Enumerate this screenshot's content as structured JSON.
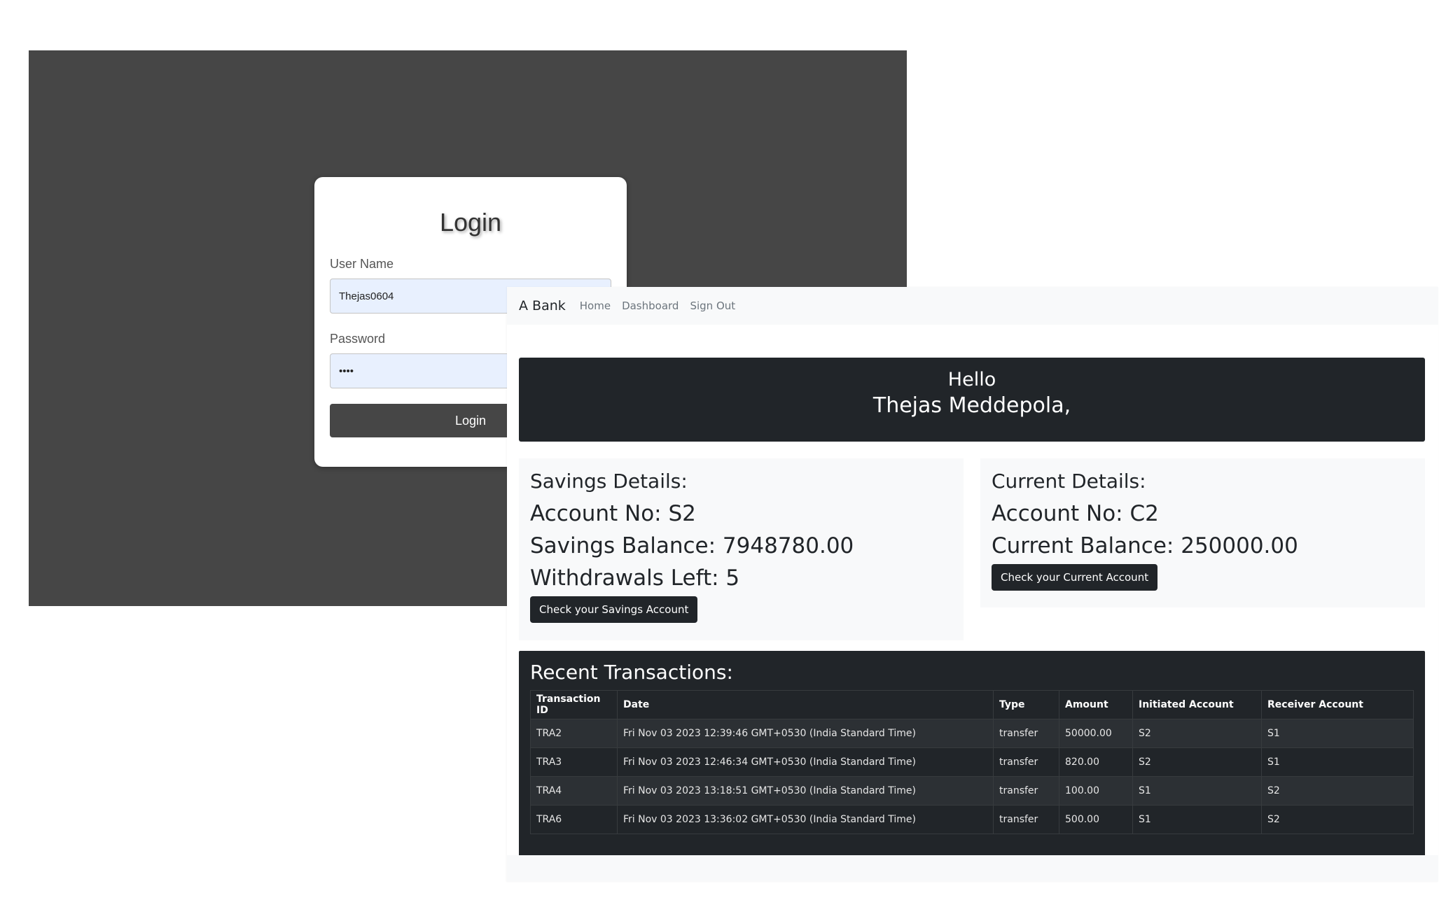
{
  "login": {
    "title": "Login",
    "username_label": "User Name",
    "username_value": "Thejas0604",
    "password_label": "Password",
    "password_value": "••••",
    "button_label": "Login"
  },
  "bank": {
    "navbar": {
      "brand": "A Bank",
      "links": [
        "Home",
        "Dashboard",
        "Sign Out"
      ]
    },
    "greeting": {
      "line1": "Hello",
      "line2": "Thejas Meddepola,"
    },
    "savings": {
      "heading": "Savings Details:",
      "account_no": "Account No: S2",
      "balance": "Savings Balance: 7948780.00",
      "withdrawals": "Withdrawals Left: 5",
      "button": "Check your Savings Account"
    },
    "current": {
      "heading": "Current Details:",
      "account_no": "Account No: C2",
      "balance": "Current Balance: 250000.00",
      "button": "Check your Current Account"
    },
    "transactions": {
      "heading": "Recent Transactions:",
      "columns": [
        "Transaction ID",
        "Date",
        "Type",
        "Amount",
        "Initiated Account",
        "Receiver Account"
      ],
      "rows": [
        [
          "TRA2",
          "Fri Nov 03 2023 12:39:46 GMT+0530 (India Standard Time)",
          "transfer",
          "50000.00",
          "S2",
          "S1"
        ],
        [
          "TRA3",
          "Fri Nov 03 2023 12:46:34 GMT+0530 (India Standard Time)",
          "transfer",
          "820.00",
          "S2",
          "S1"
        ],
        [
          "TRA4",
          "Fri Nov 03 2023 13:18:51 GMT+0530 (India Standard Time)",
          "transfer",
          "100.00",
          "S1",
          "S2"
        ],
        [
          "TRA6",
          "Fri Nov 03 2023 13:36:02 GMT+0530 (India Standard Time)",
          "transfer",
          "500.00",
          "S1",
          "S2"
        ]
      ]
    }
  }
}
